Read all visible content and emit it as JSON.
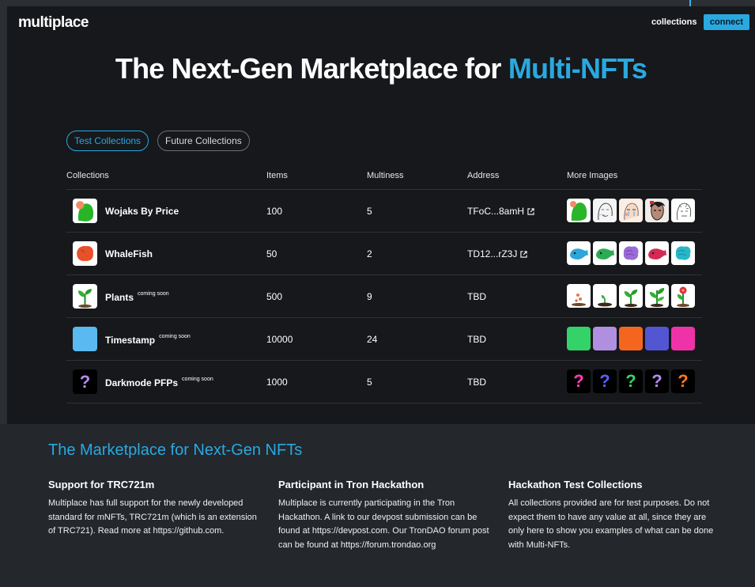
{
  "header": {
    "logo": "multiplace",
    "collections_link": "collections",
    "connect_label": "connect"
  },
  "hero": {
    "title_plain": "The Next-Gen Marketplace for ",
    "title_accent": "Multi-NFTs"
  },
  "tabs": [
    {
      "label": "Test Collections",
      "active": true
    },
    {
      "label": "Future Collections",
      "active": false
    }
  ],
  "table": {
    "headers": {
      "collections": "Collections",
      "items": "Items",
      "multiness": "Multiness",
      "address": "Address",
      "more_images": "More Images"
    },
    "rows": [
      {
        "name": "Wojaks By Price",
        "badge": "",
        "items": "100",
        "multiness": "5",
        "address": "TFoC...8amH",
        "address_link": true,
        "thumb": "wojak-icon",
        "images": [
          "wojak-green-icon",
          "wojak-sketch-icon",
          "wojak-crying-icon",
          "wojak-dark-icon",
          "wojak-sketch-alt-icon"
        ]
      },
      {
        "name": "WhaleFish",
        "badge": "",
        "items": "50",
        "multiness": "2",
        "address": "TD12...rZ3J",
        "address_link": true,
        "thumb": "whalefish-icon",
        "images": [
          "whale-blue-icon",
          "whale-green-icon",
          "whale-purple-icon",
          "whale-red-icon",
          "whale-cyan-icon"
        ]
      },
      {
        "name": "Plants",
        "badge": "coming soon",
        "items": "500",
        "multiness": "9",
        "address": "TBD",
        "address_link": false,
        "thumb": "plant-icon",
        "images": [
          "seed-icon",
          "sprout-icon",
          "seedling-icon",
          "plant-icon",
          "flower-icon"
        ]
      },
      {
        "name": "Timestamp",
        "badge": "coming soon",
        "items": "10000",
        "multiness": "24",
        "address": "TBD",
        "address_link": false,
        "thumb": "color-square-icon",
        "images": [
          "green-square-icon",
          "lavender-square-icon",
          "orange-square-icon",
          "indigo-square-icon",
          "pink-square-icon"
        ]
      },
      {
        "name": "Darkmode PFPs",
        "badge": "coming soon",
        "items": "1000",
        "multiness": "5",
        "address": "TBD",
        "address_link": false,
        "thumb": "question-mark-icon",
        "images": [
          "pink-question-icon",
          "blue-question-icon",
          "green-question-icon",
          "purple-question-icon",
          "orange-question-icon"
        ]
      }
    ]
  },
  "footer": {
    "title": "The Marketplace for Next-Gen NFTs",
    "columns": [
      {
        "heading": "Support for TRC721m",
        "text": "Multiplace has full support for the newly developed standard for mNFTs, TRC721m (which is an extension of TRC721). Read more at https://github.com."
      },
      {
        "heading": "Participant in Tron Hackathon",
        "text": "Multiplace is currently participating in the Tron Hackathon. A link to our devpost submission can be found at https://devpost.com. Our TronDAO forum post can be found at https://forum.trondao.org"
      },
      {
        "heading": "Hackathon Test Collections",
        "text": "All collections provided are for test purposes. Do not expect them to have any value at all, since they are only here to show you examples of what can be done with Multi-NFTs."
      }
    ]
  },
  "colors": {
    "accent": "#29a9e0",
    "hero_bg": "#16181b",
    "footer_bg": "#24272c",
    "timestamp": [
      "#5ab9f0",
      "#33d36a",
      "#b18fe0",
      "#f4661f",
      "#5256d2",
      "#f032a8"
    ],
    "question_marks": [
      "#ff3fb0",
      "#5560ff",
      "#33d36a",
      "#b48cf0",
      "#ff7a1a"
    ]
  }
}
